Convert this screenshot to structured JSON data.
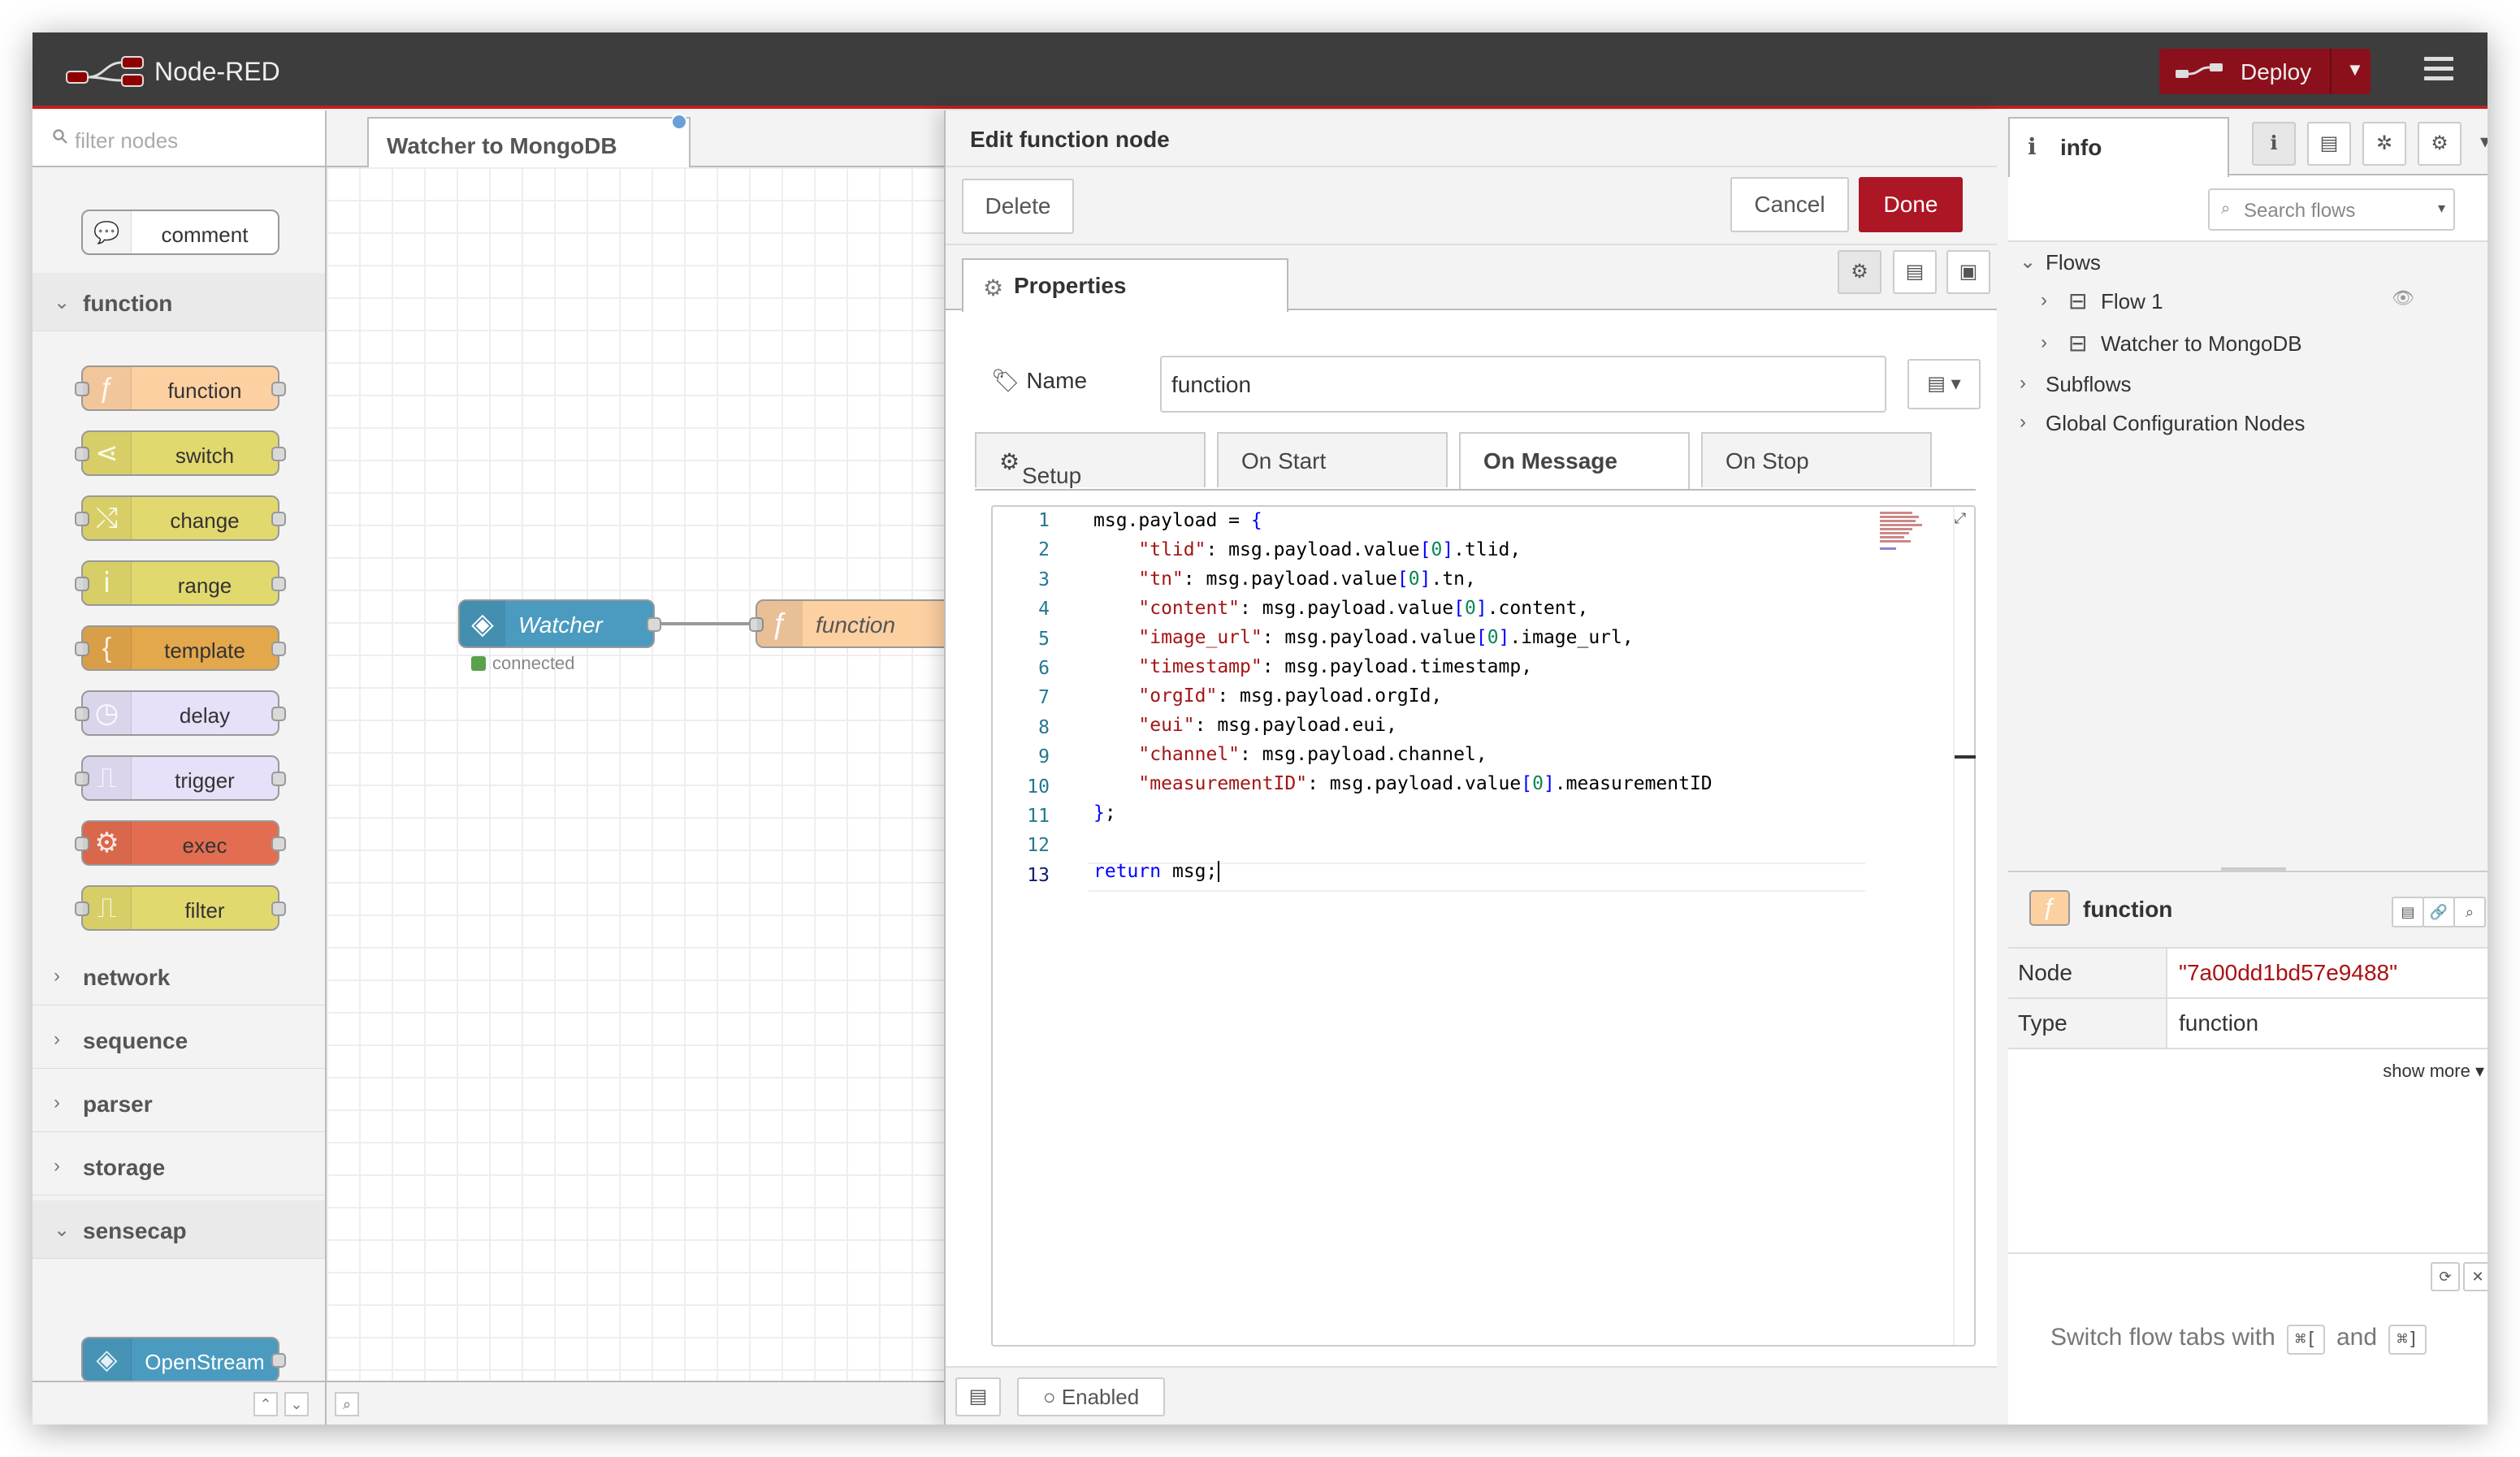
{
  "header": {
    "app_title": "Node-RED",
    "deploy_label": "Deploy",
    "accent_color": "#ad1625"
  },
  "palette": {
    "filter_placeholder": "filter nodes",
    "comment_label": "comment",
    "function_category": "function",
    "function_nodes": [
      {
        "label": "function",
        "color": "#fdd0a2"
      },
      {
        "label": "switch",
        "color": "#e2d96e"
      },
      {
        "label": "change",
        "color": "#e2d96e"
      },
      {
        "label": "range",
        "color": "#e2d96e"
      },
      {
        "label": "template",
        "color": "#e3a74c"
      },
      {
        "label": "delay",
        "color": "#e6e0f8"
      },
      {
        "label": "trigger",
        "color": "#e6e0f8"
      },
      {
        "label": "exec",
        "color": "#e36d50"
      },
      {
        "label": "filter",
        "color": "#e2d96e"
      }
    ],
    "categories": [
      "network",
      "sequence",
      "parser",
      "storage"
    ],
    "sensecap_category": "sensecap",
    "sensecap_node": "OpenStream"
  },
  "workspace": {
    "tab_label": "Watcher to MongoDB",
    "watcher_node": "Watcher",
    "watcher_status": "connected",
    "function_node": "function"
  },
  "tray": {
    "title": "Edit function node",
    "delete_label": "Delete",
    "cancel_label": "Cancel",
    "done_label": "Done",
    "properties_tab": "Properties",
    "name_label": "Name",
    "name_value": "function",
    "subtabs": [
      "Setup",
      "On Start",
      "On Message",
      "On Stop"
    ],
    "line_numbers": [
      "1",
      "2",
      "3",
      "4",
      "5",
      "6",
      "7",
      "8",
      "9",
      "10",
      "11",
      "12",
      "13"
    ],
    "enabled_label": "Enabled"
  },
  "sidebar": {
    "info_tab": "info",
    "search_placeholder": "Search flows",
    "flows_label": "Flows",
    "flow1": "Flow 1",
    "flow2": "Watcher to MongoDB",
    "subflows_label": "Subflows",
    "global_config_label": "Global Configuration Nodes",
    "info_title": "function",
    "node_key": "Node",
    "node_value": "\"7a00dd1bd57e9488\"",
    "type_key": "Type",
    "type_value": "function",
    "show_more": "show more",
    "tip_prefix": "Switch flow tabs with",
    "tip_key1": "⌘[",
    "tip_and": "and",
    "tip_key2": "⌘]"
  }
}
